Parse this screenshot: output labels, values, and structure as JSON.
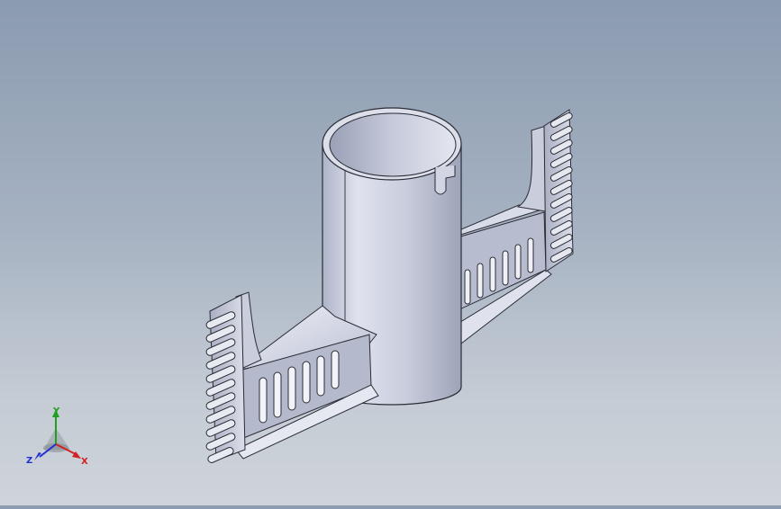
{
  "viewport": {
    "background_top": "#8b9bb0",
    "background_bottom": "#cfd4da",
    "model_color": "#c8cde0",
    "edge_color": "#2a2d36"
  },
  "triad": {
    "x_label": "X",
    "y_label": "Y",
    "z_label": "Z",
    "x_color": "#d42020",
    "y_color": "#20a020",
    "z_color": "#2030d0"
  }
}
